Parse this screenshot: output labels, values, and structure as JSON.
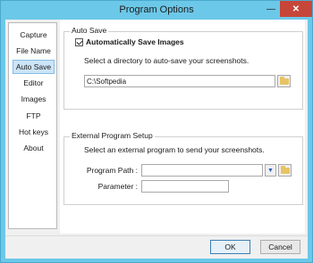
{
  "window": {
    "title": "Program Options",
    "minimize": "—",
    "maximize": "▢",
    "close": "✕"
  },
  "sidebar": {
    "items": [
      {
        "label": "Capture"
      },
      {
        "label": "File Name"
      },
      {
        "label": "Auto Save",
        "active": true
      },
      {
        "label": "Editor"
      },
      {
        "label": "Images"
      },
      {
        "label": "FTP"
      },
      {
        "label": "Hot keys"
      },
      {
        "label": "About"
      }
    ]
  },
  "auto_save": {
    "group_title": "Auto Save",
    "checkbox_label": "Automatically Save Images",
    "checked": true,
    "description": "Select a directory to auto-save your screenshots.",
    "directory_value": "C:\\Softpedia"
  },
  "external": {
    "group_title": "External Program Setup",
    "description": "Select an external program to send your screenshots.",
    "program_path_label": "Program Path :",
    "program_path_value": "",
    "parameter_label": "Parameter :",
    "parameter_value": ""
  },
  "footer": {
    "ok_label": "OK",
    "cancel_label": "Cancel"
  },
  "icons": {
    "browse": "folder-icon",
    "dropdown": "arrow-down-icon"
  }
}
